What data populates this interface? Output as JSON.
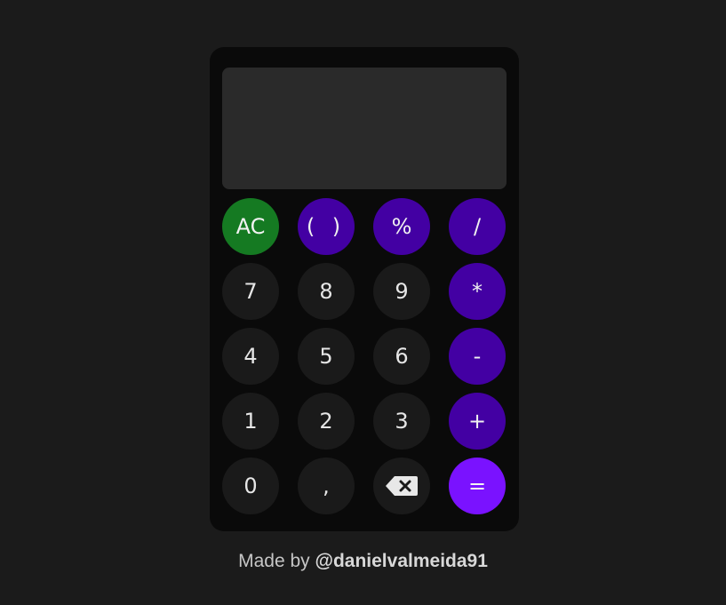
{
  "display": {
    "value": ""
  },
  "keys": {
    "clear": "AC",
    "parens": "( )",
    "percent": "%",
    "divide": "/",
    "seven": "7",
    "eight": "8",
    "nine": "9",
    "multiply": "*",
    "four": "4",
    "five": "5",
    "six": "6",
    "subtract": "-",
    "one": "1",
    "two": "2",
    "three": "3",
    "add": "+",
    "zero": "0",
    "decimal": ",",
    "backspace_icon": "backspace-icon",
    "equals": "="
  },
  "footer": {
    "prefix": "Made by",
    "handle": "@danielvalmeida91"
  },
  "colors": {
    "background": "#1b1b1b",
    "calculator": "#0a0a0a",
    "display": "#2a2a2a",
    "number_key": "#1a1a1a",
    "operator_key": "#4300a3",
    "clear_key": "#157a22",
    "equals_key": "#7a12ff"
  }
}
